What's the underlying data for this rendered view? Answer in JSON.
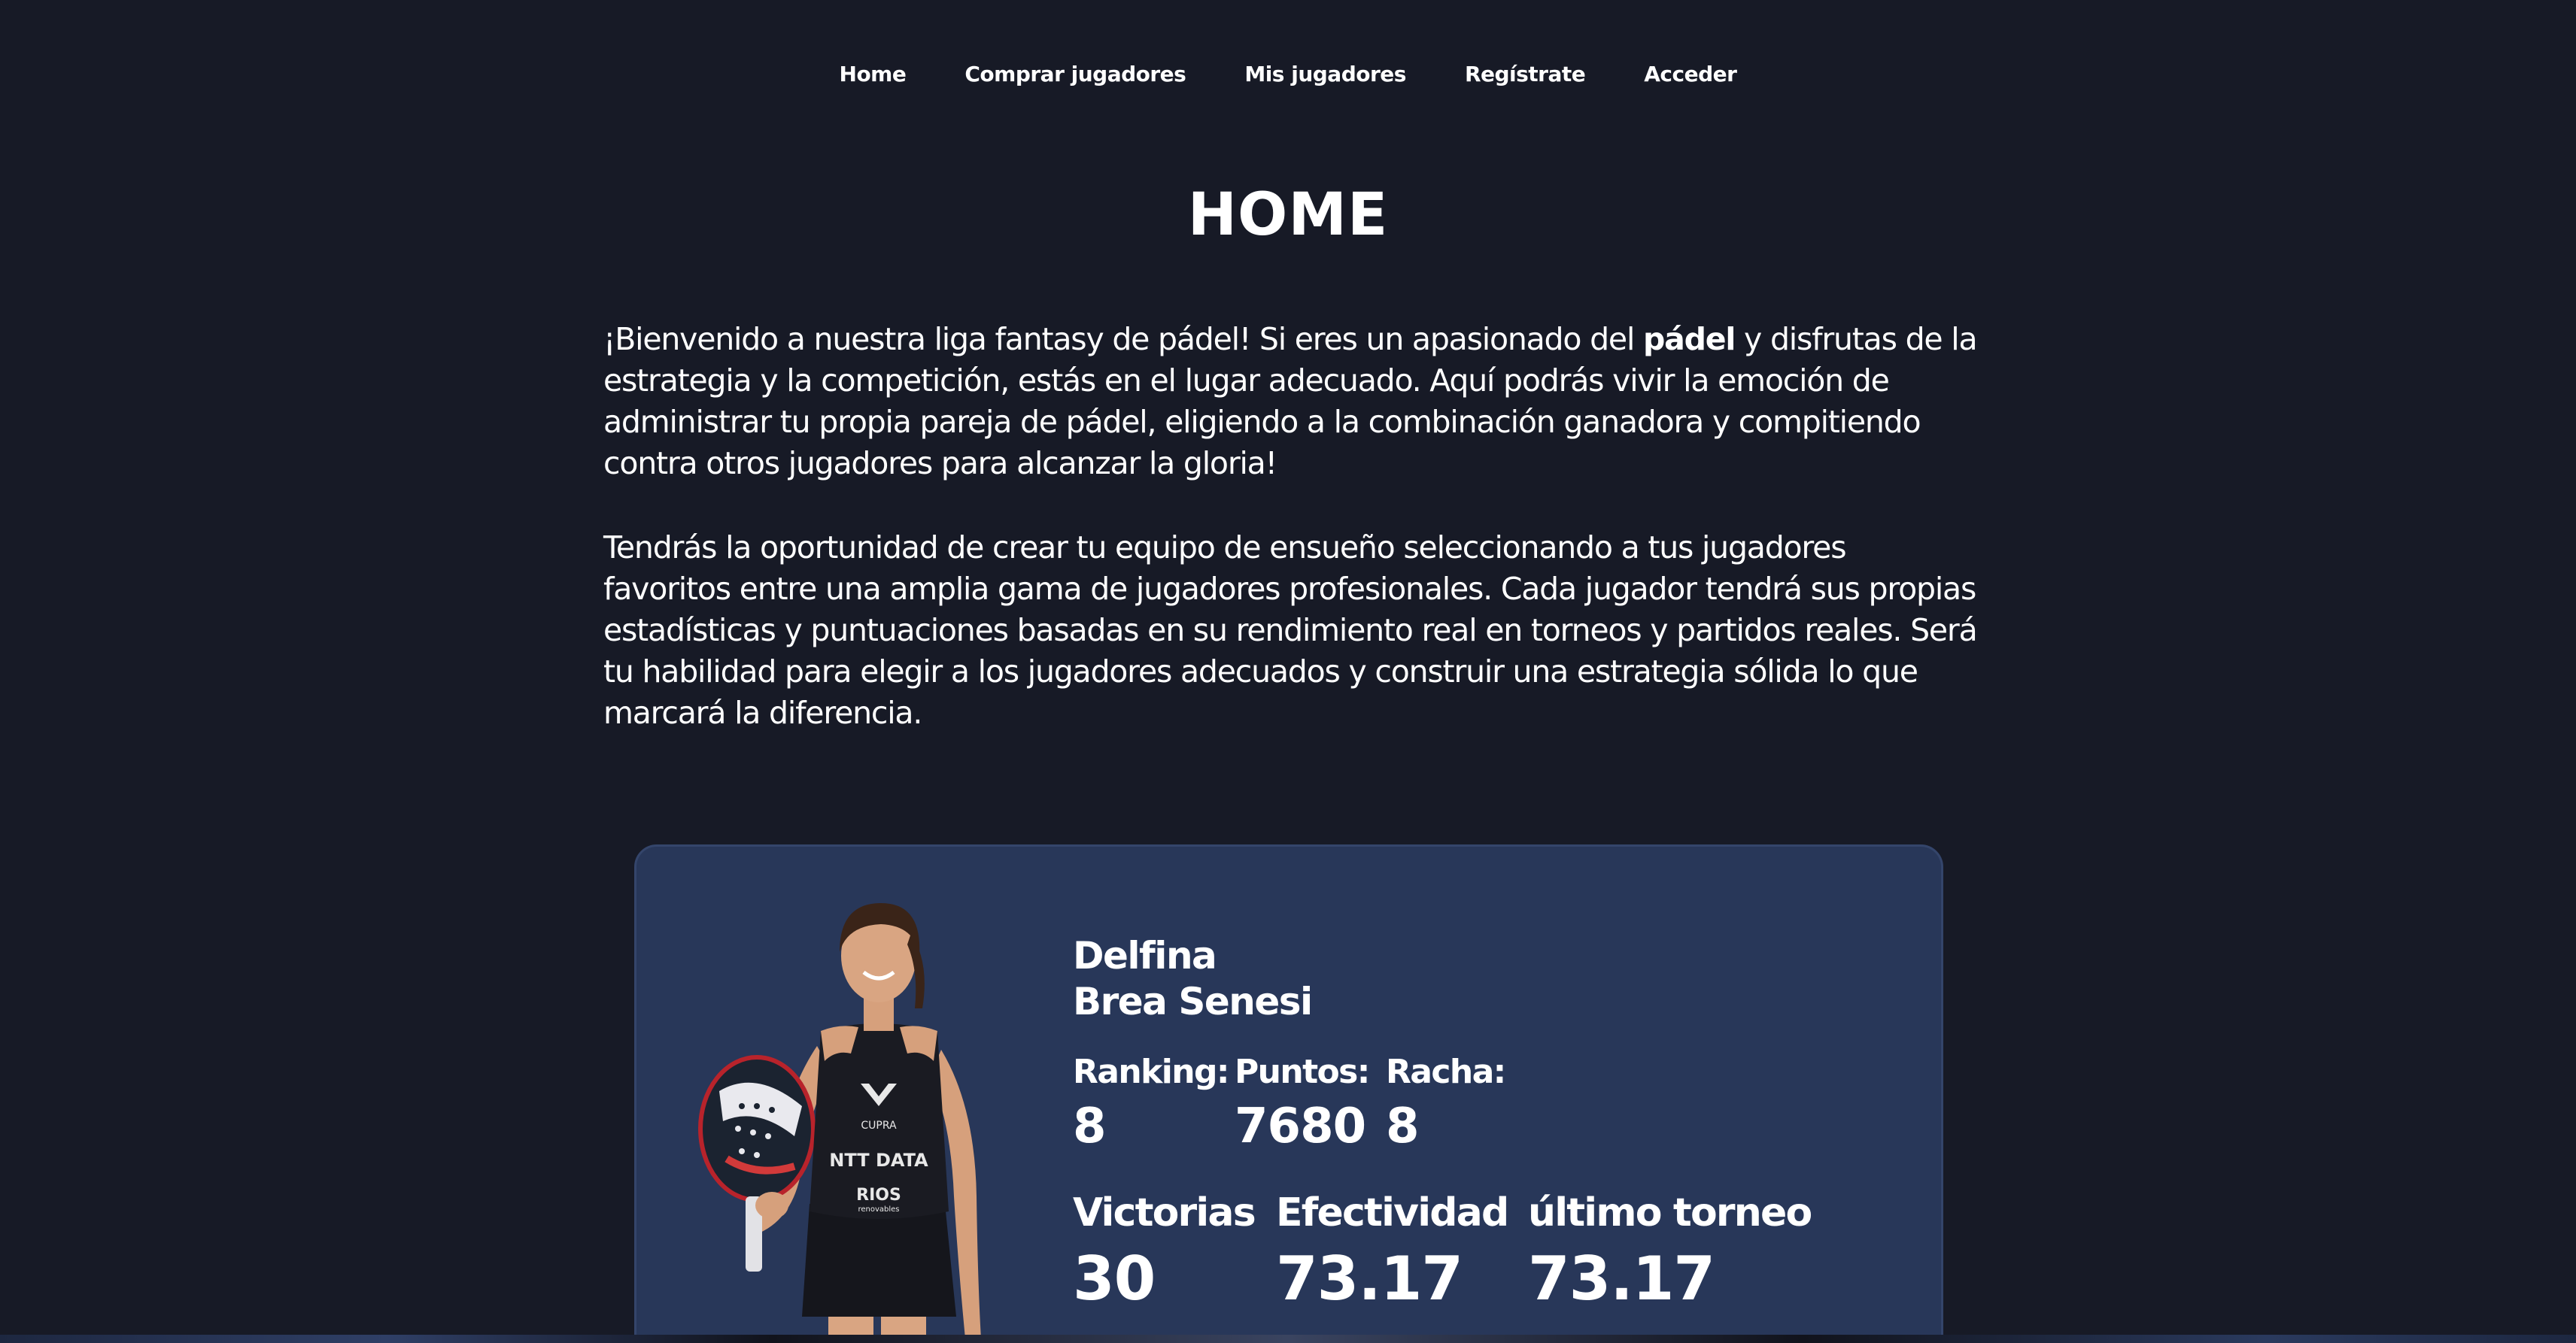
{
  "nav": {
    "items": [
      {
        "label": "Home"
      },
      {
        "label": "Comprar jugadores"
      },
      {
        "label": "Mis jugadores"
      },
      {
        "label": "Regístrate"
      },
      {
        "label": "Acceder"
      }
    ]
  },
  "page": {
    "title": "HOME"
  },
  "intro": {
    "p1_before": "¡Bienvenido a nuestra liga fantasy de pádel! Si eres un apasionado del ",
    "p1_bold": "pádel",
    "p1_after": " y disfrutas de la estrategia y la competición, estás en el lugar adecuado. Aquí podrás vivir la emoción de administrar tu propia pareja de pádel, eligiendo a la combinación ganadora y compitiendo contra otros jugadores para alcanzar la gloria!",
    "p2": "Tendrás la oportunidad de crear tu equipo de ensueño seleccionando a tus jugadores favoritos entre una amplia gama de jugadores profesionales. Cada jugador tendrá sus propias estadísticas y puntuaciones basadas en su rendimiento real en torneos y partidos reales. Será tu habilidad para elegir a los jugadores adecuados y construir una estrategia sólida lo que marcará la diferencia."
  },
  "player": {
    "first_name": "Delfina",
    "last_name": "Brea Senesi",
    "jersey_brand": "CUPRA",
    "jersey_sponsor1": "NTT DATA",
    "jersey_sponsor2": "RIOS",
    "jersey_sponsor2_sub": "renovables",
    "stats": {
      "ranking_label": "Ranking:",
      "ranking_value": "8",
      "points_label": "Puntos:",
      "points_value": "7680",
      "streak_label": "Racha:",
      "streak_value": "8",
      "wins_label": "Victorias",
      "wins_value": "30",
      "effectiveness_label": "Efectividad",
      "effectiveness_value": "73.17",
      "last_tournament_label": "último torneo",
      "last_tournament_value": "73.17"
    }
  },
  "colors": {
    "background": "#171a26",
    "card": "#283759",
    "text": "#ffffff"
  }
}
